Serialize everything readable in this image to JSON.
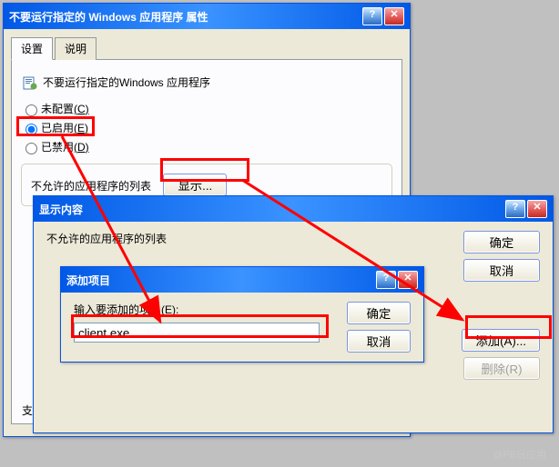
{
  "main_window": {
    "title": "不要运行指定的 Windows 应用程序 属性",
    "tabs": {
      "settings": "设置",
      "explain": "说明"
    },
    "policy_name": "不要运行指定的Windows 应用程序",
    "radio": {
      "not_configured": "未配置",
      "nc_key": "(C)",
      "enabled": "已启用",
      "en_key": "(E)",
      "disabled": "已禁用",
      "dis_key": "(D)"
    },
    "list_label": "不允许的应用程序的列表",
    "show_btn": "显示...",
    "support_prefix": "支"
  },
  "show_dialog": {
    "title": "显示内容",
    "list_label": "不允许的应用程序的列表",
    "ok": "确定",
    "cancel": "取消",
    "add": "添加(A)...",
    "remove": "删除(R)"
  },
  "add_dialog": {
    "title": "添加项目",
    "input_label": "输入要添加的项目",
    "input_key": "(E):",
    "value": "client.exe",
    "ok": "确定",
    "cancel": "取消"
  },
  "watermark": "@PB玩应用"
}
